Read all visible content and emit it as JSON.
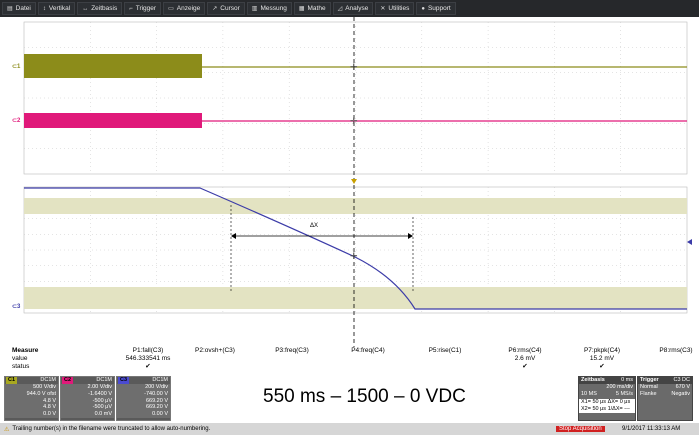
{
  "menu": [
    {
      "icon": "file-icon",
      "glyph": "▤",
      "label": "Datei"
    },
    {
      "icon": "vertical-icon",
      "glyph": "↕",
      "label": "Vertikal"
    },
    {
      "icon": "timebase-icon",
      "glyph": "↔",
      "label": "Zeitbasis"
    },
    {
      "icon": "trigger-icon",
      "glyph": "⌐",
      "label": "Trigger"
    },
    {
      "icon": "display-icon",
      "glyph": "▭",
      "label": "Anzeige"
    },
    {
      "icon": "cursor-icon",
      "glyph": "↗",
      "label": "Cursor"
    },
    {
      "icon": "measure-icon",
      "glyph": "▥",
      "label": "Messung"
    },
    {
      "icon": "math-icon",
      "glyph": "▦",
      "label": "Mathe"
    },
    {
      "icon": "analysis-icon",
      "glyph": "◿",
      "label": "Analyse"
    },
    {
      "icon": "utilities-icon",
      "glyph": "✕",
      "label": "Utilities"
    },
    {
      "icon": "support-icon",
      "glyph": "●",
      "label": "Support"
    }
  ],
  "channels": {
    "c1": {
      "label": "C1",
      "color": "#8c8c1a"
    },
    "c2": {
      "label": "C2",
      "color": "#e0197a"
    },
    "c3": {
      "label": "C3",
      "color": "#3c3ca8"
    },
    "c4": {
      "label": "C4",
      "color": "#3c3ca8"
    }
  },
  "cursor_label": "ΔX",
  "measure": {
    "row_labels": [
      "Measure",
      "value",
      "status"
    ],
    "params": [
      {
        "name": "P1:fall(C3)",
        "value": "546.333541 ms",
        "status": "✔"
      },
      {
        "name": "P2:ovsh+(C3)",
        "value": "",
        "status": ""
      },
      {
        "name": "P3:freq(C3)",
        "value": "",
        "status": ""
      },
      {
        "name": "P4:freq(C4)",
        "value": "",
        "status": ""
      },
      {
        "name": "P5:rise(C1)",
        "value": "",
        "status": ""
      },
      {
        "name": "P6:rms(C4)",
        "value": "2.6 mV",
        "status": "✔"
      },
      {
        "name": "P7:pkpk(C4)",
        "value": "15.2 mV",
        "status": "✔"
      },
      {
        "name": "P8:rms(C3)",
        "value": "",
        "status": ""
      }
    ]
  },
  "channel_panels": [
    {
      "tag": "C1",
      "coupling": "DC1M",
      "tagcolor": "#a8a820",
      "lines": [
        "500 V/div",
        "944.0 V ofst",
        "4.8 V",
        "4.8 V",
        "0.0 V"
      ]
    },
    {
      "tag": "C2",
      "coupling": "DC1M",
      "tagcolor": "#e0197a",
      "lines": [
        "2.00 V/div",
        "-1.6400 V",
        "-500 μV",
        "-500 μV",
        "0.0 mV"
      ]
    },
    {
      "tag": "C3",
      "coupling": "DC1M",
      "tagcolor": "#4a4ad0",
      "lines": [
        "200 V/div",
        "-740.00 V",
        "669.20 V",
        "669.20 V",
        "0.00 V"
      ]
    }
  ],
  "caption": "550 ms – 1500 – 0 VDC",
  "timebase": {
    "title": "Zeitbasis",
    "offset": "0 ms",
    "rate": "200 ms/div",
    "samples": "10 MS",
    "srate": "5 MS/s"
  },
  "trigger": {
    "title": "Trigger",
    "ch": "C3 DC",
    "mode": "Normal",
    "level": "670 V",
    "edge": "Flanke",
    "slope": "Negativ"
  },
  "cursors": {
    "x1": "X1=",
    "x1v": "50 μs",
    "dx": "ΔX=",
    "dxv": "0 μs",
    "x2": "X2=",
    "x2v": "50 μs",
    "idx": "1/ΔX=",
    "idxv": "---"
  },
  "status": {
    "message": "Trailing number(s) in the filename were truncated to allow auto-numbering.",
    "acq": "Stop Acquisition",
    "datetime": "9/1/2017 11:33:13 AM"
  }
}
